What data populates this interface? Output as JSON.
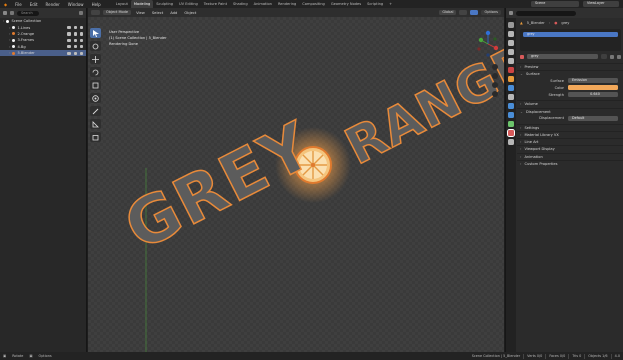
{
  "menubar": {
    "menus": [
      "File",
      "Edit",
      "Render",
      "Window",
      "Help"
    ],
    "workspaces": [
      "Layout",
      "Modeling",
      "Sculpting",
      "UV Editing",
      "Texture Paint",
      "Shading",
      "Animation",
      "Rendering",
      "Compositing",
      "Geometry Nodes",
      "Scripting"
    ],
    "active_workspace": "Modeling",
    "add_tab": "+",
    "scene_label": "Scene",
    "view_layer_label": "ViewLayer"
  },
  "outliner": {
    "search_placeholder": "Search",
    "rows": [
      {
        "label": "Scene Collection",
        "indent": 0,
        "color": "#ffffff"
      },
      {
        "label": "1.Lines",
        "indent": 1,
        "color": "#f3f3f3"
      },
      {
        "label": "2.Orange",
        "indent": 1,
        "color": "#e07a2e"
      },
      {
        "label": "3.Frames",
        "indent": 1,
        "color": "#f3f3f3"
      },
      {
        "label": "4.Bg",
        "indent": 1,
        "color": "#f3f3f3"
      },
      {
        "label": "5.Blender",
        "indent": 1,
        "color": "#e07a2e"
      }
    ],
    "selected_index": 5
  },
  "viewport": {
    "mode": "Object Mode",
    "menus": [
      "View",
      "Select",
      "Add",
      "Object"
    ],
    "shading_label": "Global",
    "options_label": "Options",
    "info_lines": [
      "User Perspective",
      "(1) Scene Collection | 5_Blender",
      "Rendering Done"
    ],
    "logo_text_1": "GREY",
    "logo_text_2": "RANGE",
    "logo_colors": {
      "fill": "#5a5a5a",
      "outline": "#e07a2e",
      "glow": "#f7c27a"
    }
  },
  "properties": {
    "object_label": "5_Blender",
    "material_label": "grey",
    "slot_label": "grey",
    "material_field": "grey",
    "sections": [
      {
        "label": "Preview",
        "open": false
      },
      {
        "label": "Surface",
        "open": true
      }
    ],
    "surface_field": {
      "label": "Surface",
      "value": "Emission"
    },
    "color_field": {
      "label": "Color",
      "value": ""
    },
    "strength_field": {
      "label": "Strength",
      "value": "0.640"
    },
    "sections_after": [
      {
        "label": "Volume",
        "open": false
      },
      {
        "label": "Displacement",
        "open": true
      }
    ],
    "displacement_field": {
      "label": "Displacement",
      "value": "Default"
    },
    "sections_tail": [
      {
        "label": "Settings"
      },
      {
        "label": "Material Library VX"
      },
      {
        "label": "Line Art"
      },
      {
        "label": "Viewport Display"
      },
      {
        "label": "Animation"
      },
      {
        "label": "Custom Properties"
      }
    ]
  },
  "statusbar": {
    "left": [
      "Rotate",
      "Options"
    ],
    "right": [
      "Scene Collection | 5_Blender",
      "Verts 0/0",
      "Faces 0/0",
      "Tris 0",
      "Objects 1/6",
      "4.0"
    ]
  }
}
